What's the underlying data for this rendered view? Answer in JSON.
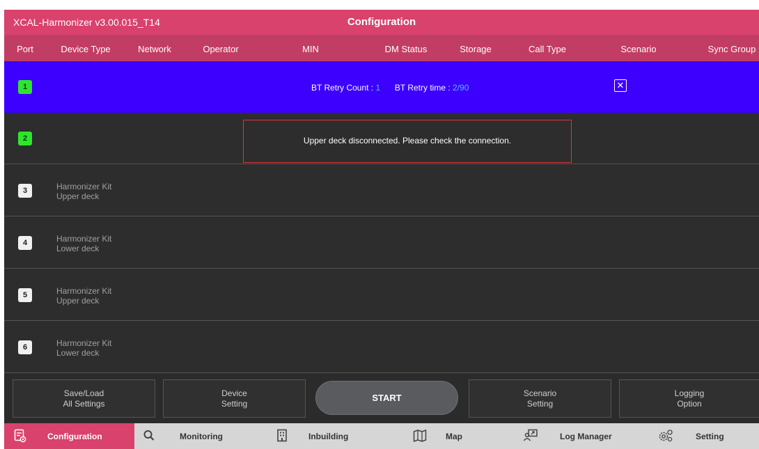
{
  "titlebar": {
    "app_name": "XCAL-Harmonizer v3.00.015_T14",
    "title": "Configuration"
  },
  "columns": [
    "Port",
    "Device Type",
    "Network",
    "Operator",
    "MIN",
    "DM Status",
    "Storage",
    "Call Type",
    "Scenario",
    "Sync Group"
  ],
  "rows": [
    {
      "port": "1",
      "badge": "green",
      "selected": true,
      "bt_retry_count_label": "BT Retry Count :",
      "bt_retry_count": "1",
      "bt_retry_time_label": "BT Retry time :",
      "bt_retry_time": "2/90",
      "scenario_icon": "close-box-icon"
    },
    {
      "port": "2",
      "badge": "green",
      "message": "Upper deck disconnected. Please check the connection."
    },
    {
      "port": "3",
      "badge": "white",
      "device_line1": "Harmonizer Kit",
      "device_line2": "Upper deck"
    },
    {
      "port": "4",
      "badge": "white",
      "device_line1": "Harmonizer Kit",
      "device_line2": "Lower deck"
    },
    {
      "port": "5",
      "badge": "white",
      "device_line1": "Harmonizer Kit",
      "device_line2": "Upper deck"
    },
    {
      "port": "6",
      "badge": "white",
      "device_line1": "Harmonizer Kit",
      "device_line2": "Lower deck"
    }
  ],
  "actions": {
    "save_load": "Save/Load\nAll Settings",
    "device_setting": "Device\nSetting",
    "start": "START",
    "scenario_setting": "Scenario\nSetting",
    "logging_option": "Logging\nOption"
  },
  "nav": [
    {
      "label": "Configuration",
      "icon": "configuration-icon",
      "active": true
    },
    {
      "label": "Monitoring",
      "icon": "search-icon"
    },
    {
      "label": "Inbuilding",
      "icon": "building-icon"
    },
    {
      "label": "Map",
      "icon": "map-icon"
    },
    {
      "label": "Log Manager",
      "icon": "log-manager-icon"
    },
    {
      "label": "Setting",
      "icon": "gear-icon"
    }
  ],
  "colors": {
    "title_bar": "#d8426d",
    "header_bar": "#c23d63",
    "selected_row": "#3d00ff",
    "port_active": "#2ee52e",
    "warning_border": "#d93636",
    "bt_value": "#5ab8ff"
  }
}
